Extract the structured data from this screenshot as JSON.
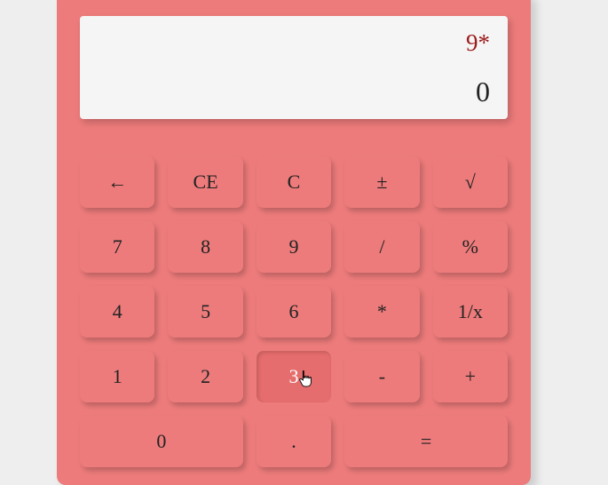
{
  "display": {
    "expression": "9*",
    "result": "0"
  },
  "keys": {
    "backspace": "←",
    "ce": "CE",
    "c": "C",
    "plusminus": "±",
    "sqrt": "√",
    "7": "7",
    "8": "8",
    "9": "9",
    "divide": "/",
    "percent": "%",
    "4": "4",
    "5": "5",
    "6": "6",
    "multiply": "*",
    "reciprocal": "1/x",
    "1": "1",
    "2": "2",
    "3": "3",
    "minus": "-",
    "plus": "+",
    "0": "0",
    "decimal": ".",
    "equals": "="
  },
  "colors": {
    "body_bg": "#ed7b7b",
    "page_bg": "#eeeeee",
    "display_bg": "#f5f5f5",
    "expression_color": "#9c1a1a"
  }
}
